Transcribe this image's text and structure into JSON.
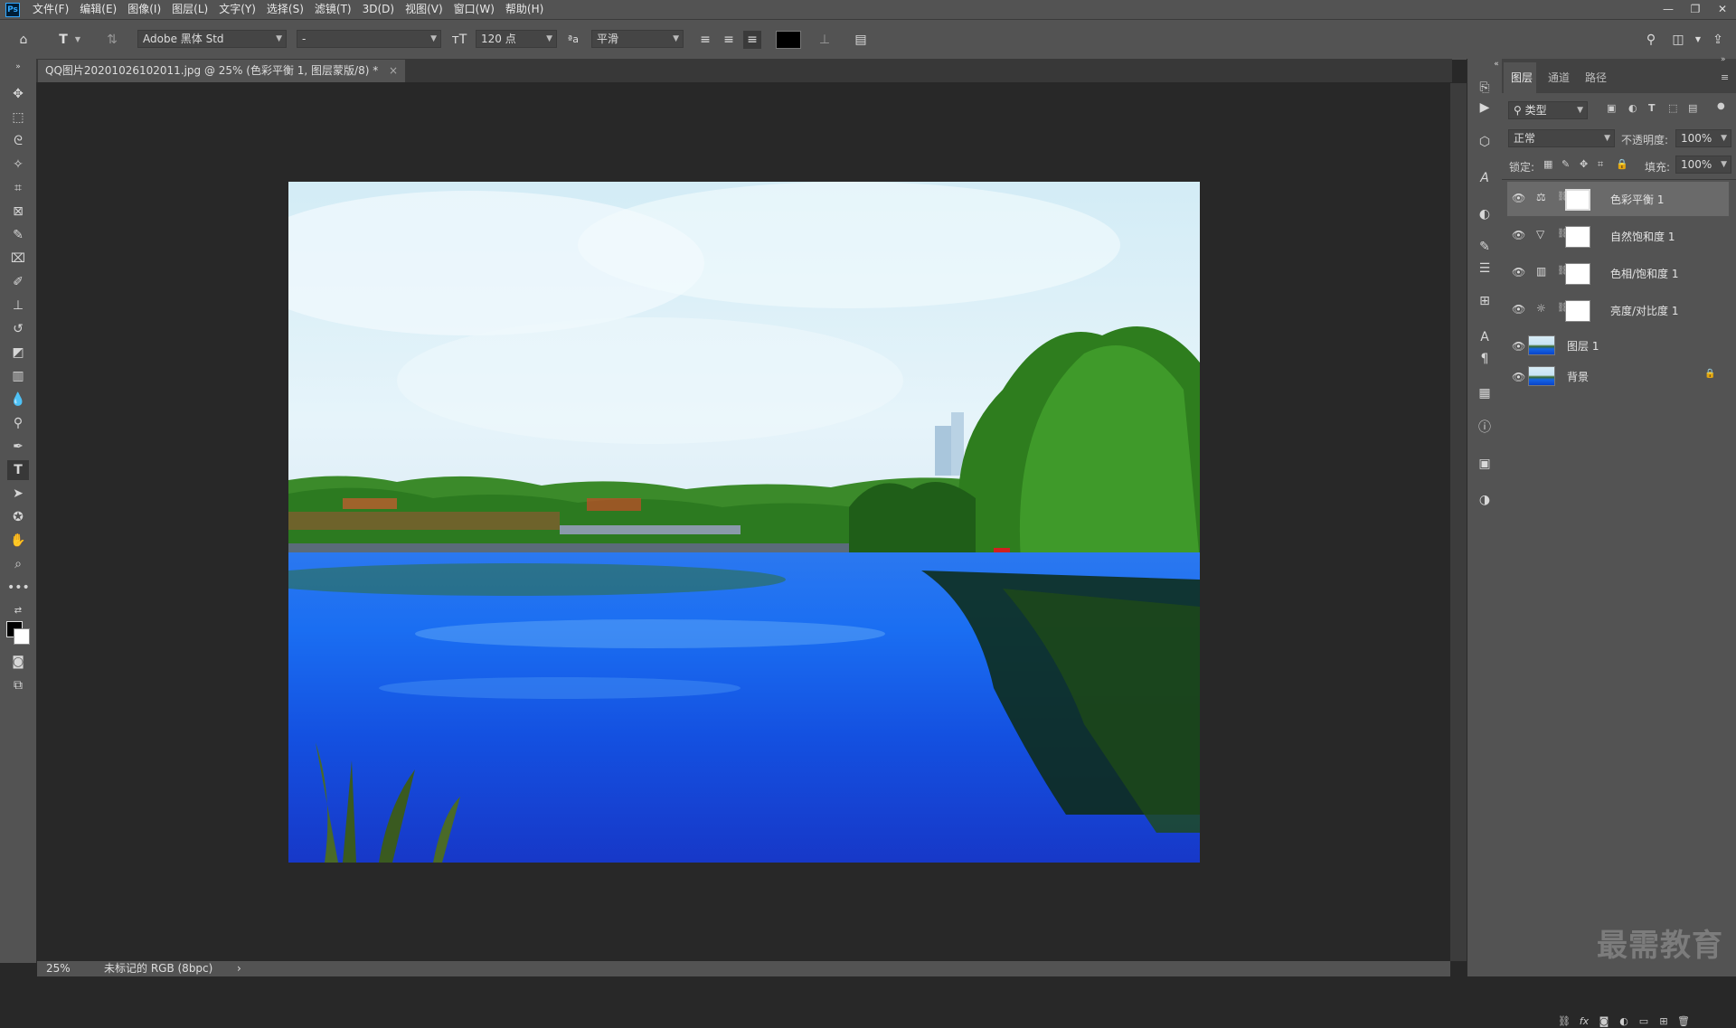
{
  "app": {
    "logo": "Ps"
  },
  "menu": [
    "文件(F)",
    "编辑(E)",
    "图像(I)",
    "图层(L)",
    "文字(Y)",
    "选择(S)",
    "滤镜(T)",
    "3D(D)",
    "视图(V)",
    "窗口(W)",
    "帮助(H)"
  ],
  "window_controls": {
    "minimize": "—",
    "restore": "❐",
    "close": "✕"
  },
  "options": {
    "font_family": "Adobe 黑体 Std",
    "font_style": "-",
    "font_size": "120 点",
    "aa_label": "aa",
    "anti_alias": "平滑",
    "text_color": "#000000"
  },
  "document": {
    "tab_title": "QQ图片20201026102011.jpg @ 25% (色彩平衡 1, 图层蒙版/8) *",
    "close": "×"
  },
  "status": {
    "zoom": "25%",
    "profile": "未标记的 RGB (8bpc)",
    "arrow": "›"
  },
  "panel": {
    "tabs": [
      "图层",
      "通道",
      "路径"
    ],
    "filter_label": "类型",
    "blend_mode": "正常",
    "opacity_label": "不透明度:",
    "opacity_value": "100%",
    "lock_label": "锁定:",
    "fill_label": "填充:",
    "fill_value": "100%",
    "layers": [
      {
        "name": "色彩平衡 1",
        "type": "color-balance",
        "icon": "scale-icon",
        "selected": true
      },
      {
        "name": "自然饱和度 1",
        "type": "vibrance",
        "icon": "triangle-icon",
        "selected": false
      },
      {
        "name": "色相/饱和度 1",
        "type": "hue-saturation",
        "icon": "hue-icon",
        "selected": false
      },
      {
        "name": "亮度/对比度 1",
        "type": "brightness-contrast",
        "icon": "sun-icon",
        "selected": false
      },
      {
        "name": "图层 1",
        "type": "pixel",
        "icon": "",
        "selected": false
      },
      {
        "name": "背景",
        "type": "background",
        "icon": "",
        "selected": false,
        "locked": true
      }
    ]
  },
  "watermark": "最需教育",
  "colors": {
    "ui_bg": "#535353",
    "canvas_bg": "#282828",
    "selected_layer": "#6a6a6a"
  }
}
